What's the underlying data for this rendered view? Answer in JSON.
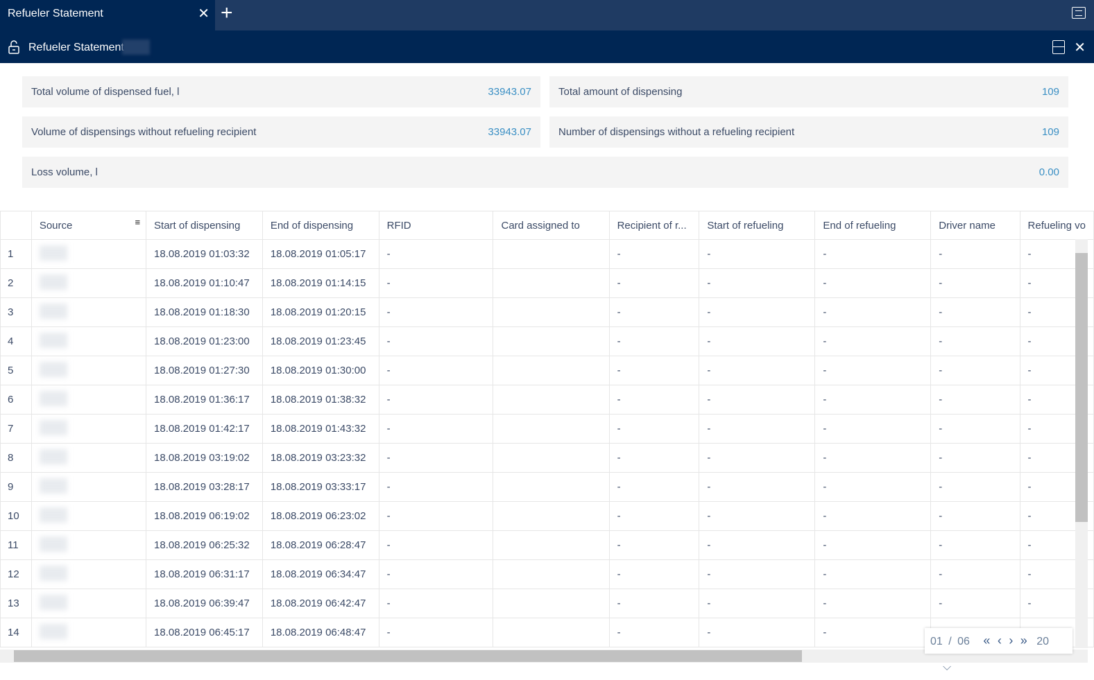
{
  "tabs": [
    {
      "label": "Refueler Statement"
    }
  ],
  "title": "Refueler Statement",
  "stats": [
    {
      "label": "Total volume of dispensed fuel, l",
      "value": "33943.07"
    },
    {
      "label": "Total amount of dispensing",
      "value": "109"
    },
    {
      "label": "Volume of dispensings without refueling recipient",
      "value": "33943.07"
    },
    {
      "label": "Number of dispensings without a refueling recipient",
      "value": "109"
    },
    {
      "label": "Loss volume, l",
      "value": "0.00"
    }
  ],
  "columns": [
    "",
    "Source",
    "Start of dispensing",
    "End of dispensing",
    "RFID",
    "Card assigned to",
    "Recipient of r...",
    "Start of refueling",
    "End of refueling",
    "Driver name",
    "Refueling vo"
  ],
  "rows": [
    [
      "1",
      "18.08.2019 01:03:32",
      "18.08.2019 01:05:17"
    ],
    [
      "2",
      "18.08.2019 01:10:47",
      "18.08.2019 01:14:15"
    ],
    [
      "3",
      "18.08.2019 01:18:30",
      "18.08.2019 01:20:15"
    ],
    [
      "4",
      "18.08.2019 01:23:00",
      "18.08.2019 01:23:45"
    ],
    [
      "5",
      "18.08.2019 01:27:30",
      "18.08.2019 01:30:00"
    ],
    [
      "6",
      "18.08.2019 01:36:17",
      "18.08.2019 01:38:32"
    ],
    [
      "7",
      "18.08.2019 01:42:17",
      "18.08.2019 01:43:32"
    ],
    [
      "8",
      "18.08.2019 03:19:02",
      "18.08.2019 03:23:32"
    ],
    [
      "9",
      "18.08.2019 03:28:17",
      "18.08.2019 03:33:17"
    ],
    [
      "10",
      "18.08.2019 06:19:02",
      "18.08.2019 06:23:02"
    ],
    [
      "11",
      "18.08.2019 06:25:32",
      "18.08.2019 06:28:47"
    ],
    [
      "12",
      "18.08.2019 06:31:17",
      "18.08.2019 06:34:47"
    ],
    [
      "13",
      "18.08.2019 06:39:47",
      "18.08.2019 06:42:47"
    ],
    [
      "14",
      "18.08.2019 06:45:17",
      "18.08.2019 06:48:47"
    ]
  ],
  "dash": "-",
  "pager": {
    "page": "01",
    "sep": "/",
    "total": "06",
    "per_page": "20"
  }
}
